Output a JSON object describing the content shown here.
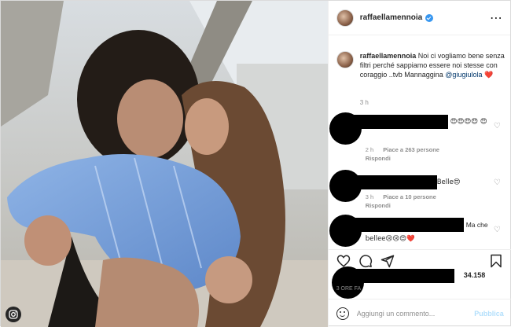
{
  "post": {
    "username": "raffaellamennoia",
    "caption_text": " Noi ci vogliamo bene senza filtri perché sappiamo essere noi stesse con coraggio ..tvb Mannaggina ",
    "mention": "@giugiulola",
    "heart": "❤️",
    "caption_time": "3 h",
    "likes_count": "34.158",
    "post_time": "3 ORE FA"
  },
  "comments": [
    {
      "text": "😍😍😍😍 😍",
      "time": "2 h",
      "likes": "Piace a 263 persone",
      "reply": "Rispondi"
    },
    {
      "text": "Belle😍",
      "time": "3 h",
      "likes": "Piace a 10 persone",
      "reply": "Rispondi"
    },
    {
      "text_a": "Ma che",
      "text_b": "bellee😢😢😍❤️"
    }
  ],
  "comment_box": {
    "placeholder": "Aggiungi un commento...",
    "publish": "Pubblica"
  },
  "colors": {
    "accent": "#3897f0",
    "heart": "#ed4956",
    "publish_disabled": "#b2dffc"
  },
  "icons": [
    "verified-icon",
    "close-icon",
    "like-icon",
    "comment-icon",
    "share-icon",
    "save-icon",
    "emoji-icon",
    "instagram-icon"
  ]
}
